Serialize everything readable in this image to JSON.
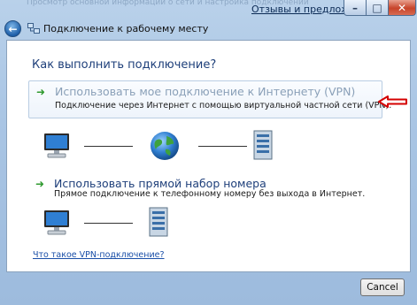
{
  "window": {
    "blurred_title": "Просмотр основной информации о сети и настройка подключений",
    "title": "Подключение к рабочему месту",
    "feedback_link": "Отзывы и предложения"
  },
  "question": "Как выполнить подключение?",
  "options": [
    {
      "title": "Использовать мое подключение к Интернету (VPN)",
      "description": "Подключение через Интернет с помощью виртуальной частной сети (VPN)."
    },
    {
      "title": "Использовать прямой набор номера",
      "description": "Прямое подключение к телефонному номеру без выхода в Интернет."
    }
  ],
  "help_link": "Что такое VPN-подключение?",
  "buttons": {
    "cancel": "Cancel"
  },
  "icons": {
    "back": "back-arrow-icon",
    "computer": "computer-monitor-icon",
    "globe": "globe-icon",
    "server": "server-tower-icon",
    "option_arrow": "green-arrow-icon",
    "annotation": "red-arrow-annotation"
  },
  "colors": {
    "accent": "#1e3f7a",
    "link": "#1a4fa8",
    "option_arrow": "#2f9a2f",
    "annotation": "#d40000"
  }
}
